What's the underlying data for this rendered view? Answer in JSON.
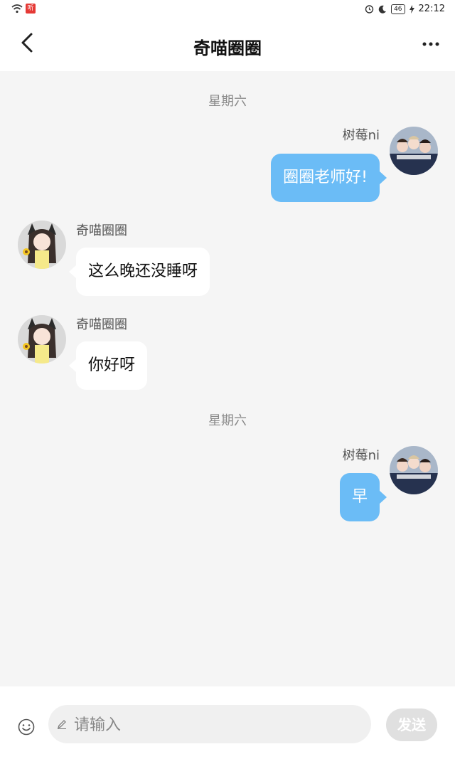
{
  "status_bar": {
    "app_badge": "听",
    "battery": "46",
    "time": "22:12"
  },
  "header": {
    "title": "奇喵圈圈",
    "back_icon": "chevron-left-icon",
    "more_icon": "more-horizontal-icon"
  },
  "messages": [
    {
      "type": "date",
      "text": "星期六"
    },
    {
      "type": "outgoing",
      "sender": "树莓ni",
      "text": "圈圈老师好!"
    },
    {
      "type": "incoming",
      "sender": "奇喵圈圈",
      "text": "这么晚还没睡呀"
    },
    {
      "type": "incoming",
      "sender": "奇喵圈圈",
      "text": "你好呀"
    },
    {
      "type": "date",
      "text": "星期六"
    },
    {
      "type": "outgoing",
      "sender": "树莓ni",
      "text": "早"
    }
  ],
  "input": {
    "placeholder": "请输入",
    "send_label": "发送",
    "emoji_icon": "emoji-icon",
    "pencil_icon": "pencil-icon"
  },
  "colors": {
    "outgoing_bubble": "#6bbcf6",
    "incoming_bubble": "#ffffff",
    "background": "#f5f5f5",
    "send_disabled": "#e0e0e0"
  }
}
